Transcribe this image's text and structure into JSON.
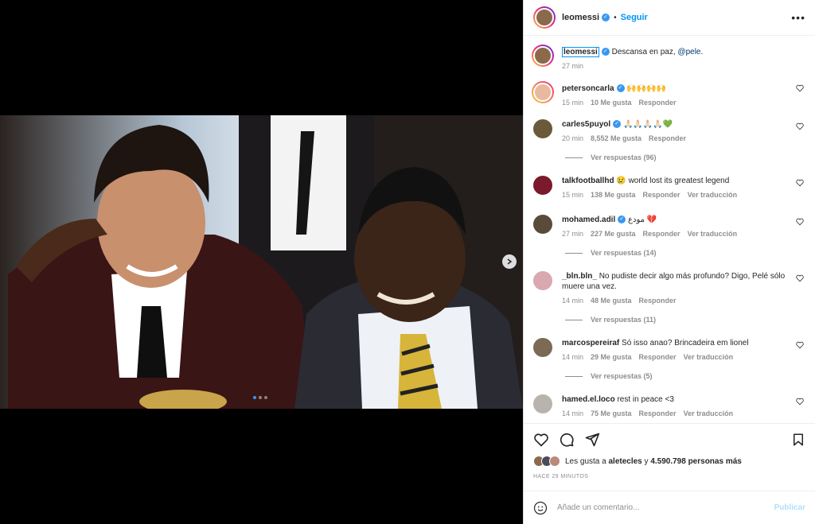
{
  "post": {
    "username": "leomessi",
    "separator": "•",
    "follow_label": "Seguir",
    "more_icon": "more-icon",
    "caption": {
      "username": "leomessi",
      "text": "Descansa en paz, ",
      "mention": "@pele.",
      "time": "27 min"
    }
  },
  "media": {
    "carousel_index": 1,
    "carousel_total": 3
  },
  "comments": [
    {
      "username": "petersoncarla",
      "text": "🙌🙌🙌🙌",
      "time": "15 min",
      "likes": "10 Me gusta",
      "reply": "Responder",
      "translate": ""
    },
    {
      "username": "carles5puyol",
      "text": "🙏🏻🙏🏻🙏🏻🙏🏻💚",
      "time": "20 min",
      "likes": "8,552 Me gusta",
      "reply": "Responder",
      "translate": "",
      "replies": "Ver respuestas (96)"
    },
    {
      "username": "talkfootballhd",
      "text": "😢 world lost its greatest legend",
      "time": "15 min",
      "likes": "138 Me gusta",
      "reply": "Responder",
      "translate": "Ver traducción"
    },
    {
      "username": "mohamed.adil",
      "text": "مودع 💔",
      "time": "27 min",
      "likes": "227 Me gusta",
      "reply": "Responder",
      "translate": "Ver traducción",
      "replies": "Ver respuestas (14)"
    },
    {
      "username": "_bln.bln_",
      "text": "No pudiste decir algo más profundo? Digo, Pelé sólo muere una vez.",
      "time": "14 min",
      "likes": "48 Me gusta",
      "reply": "Responder",
      "translate": "",
      "replies": "Ver respuestas (11)"
    },
    {
      "username": "marcospereiraf",
      "text": "Só isso anao? Brincadeira em lionel",
      "time": "14 min",
      "likes": "29 Me gusta",
      "reply": "Responder",
      "translate": "Ver traducción",
      "replies": "Ver respuestas (5)"
    },
    {
      "username": "hamed.el.loco",
      "text": "rest in peace <3",
      "time": "14 min",
      "likes": "75 Me gusta",
      "reply": "Responder",
      "translate": "Ver traducción"
    }
  ],
  "likes": {
    "prefix": "Les gusta a ",
    "user": "aletecles",
    "middle": " y ",
    "count": "4.590.798 personas más"
  },
  "time_ago": "HACE 29 MINUTOS",
  "add_comment": {
    "placeholder": "Añade un comentario...",
    "publish_label": "Publicar"
  },
  "colors": {
    "accent": "#0095f6",
    "verified": "#3897f0",
    "muted": "#8e8e8e",
    "text": "#262626"
  }
}
